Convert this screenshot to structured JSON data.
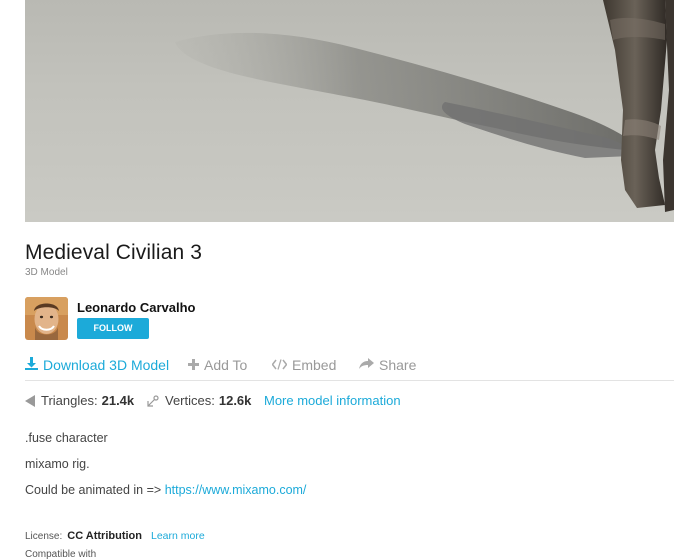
{
  "model": {
    "title": "Medieval Civilian 3",
    "type_label": "3D Model"
  },
  "author": {
    "name": "Leonardo Carvalho",
    "follow_label": "FOLLOW"
  },
  "actions": {
    "download_label": "Download 3D Model",
    "add_to_label": "Add To",
    "embed_label": "Embed",
    "share_label": "Share"
  },
  "stats": {
    "triangles_label": "Triangles:",
    "triangles_value": "21.4k",
    "vertices_label": "Vertices:",
    "vertices_value": "12.6k",
    "more_info_label": "More model information"
  },
  "description": {
    "line1": ".fuse character",
    "line2": "mixamo rig.",
    "line3_prefix": "Could be animated in =>",
    "line3_link": "https://www.mixamo.com/"
  },
  "license": {
    "label": "License:",
    "name": "CC Attribution",
    "learn_more": "Learn more"
  },
  "compatibility": {
    "label": "Compatible with"
  },
  "colors": {
    "accent": "#1caad9",
    "muted": "#999999"
  },
  "icons": {
    "download": "download-icon",
    "add": "plus-icon",
    "embed": "code-icon",
    "share": "share-arrow-icon",
    "triangles": "triangle-icon",
    "vertices": "vertex-icon"
  }
}
